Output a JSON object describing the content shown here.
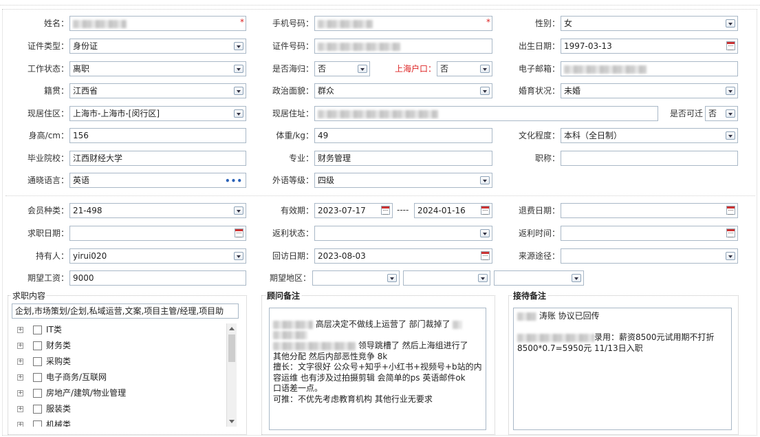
{
  "form": {
    "name_label": "姓名：",
    "phone_label": "手机号码：",
    "gender_label": "性别：",
    "gender_value": "女",
    "idtype_label": "证件类型：",
    "idtype_value": "身份证",
    "idnum_label": "证件号码：",
    "birth_label": "出生日期：",
    "birth_value": "1997-03-13",
    "workstatus_label": "工作状态：",
    "workstatus_value": "离职",
    "returnee_label": "是否海归：",
    "returnee_value": "否",
    "hukou_label": "上海户口：",
    "hukou_value": "否",
    "email_label": "电子邮箱：",
    "native_label": "籍贯：",
    "native_value": "江西省",
    "political_label": "政治面貌：",
    "political_value": "群众",
    "marital_label": "婚育状况：",
    "marital_value": "未婚",
    "area_label": "现居住区：",
    "area_value": "上海市-上海市-[闵行区]",
    "address_label": "现居住址：",
    "relocate_label": "是否可迁",
    "relocate_value": "否",
    "height_label": "身高/cm：",
    "height_value": "156",
    "weight_label": "体重/kg：",
    "weight_value": "49",
    "education_label": "文化程度：",
    "education_value": "本科（全日制）",
    "school_label": "毕业院校：",
    "school_value": "江西财经大学",
    "major_label": "专业：",
    "major_value": "财务管理",
    "title_label": "职称：",
    "title_value": "",
    "language_label": "通晓语言：",
    "language_value": "英语",
    "langlevel_label": "外语等级：",
    "langlevel_value": "四级"
  },
  "membership": {
    "type_label": "会员种类：",
    "type_value": "21-498",
    "valid_label": "有效期：",
    "valid_from": "2023-07-17",
    "valid_sep": "----",
    "valid_to": "2024-01-16",
    "refund_date_label": "退费日期：",
    "jobseek_date_label": "求职日期：",
    "rebate_status_label": "返利状态：",
    "rebate_time_label": "返利时间：",
    "holder_label": "持有人：",
    "holder_value": "yirui020",
    "revisit_label": "回访日期：",
    "revisit_value": "2023-08-03",
    "source_label": "来源途径：",
    "salary_label": "期望工资：",
    "salary_value": "9000",
    "region_label": "期望地区："
  },
  "job_content": {
    "title": "求职内容",
    "summary": "企划,市场策划/企划,私域运营,文案,项目主管/经理,项目助",
    "items": [
      "IT类",
      "财务类",
      "采购类",
      "电子商务/互联网",
      "房地产/建筑/物业管理",
      "服装类",
      "机械类"
    ]
  },
  "consultant_notes": {
    "title": "顾问备注",
    "lines": [
      "高层决定不做线上运营了  部门裁掉了",
      "领导跳槽了 然后上海组进行了",
      "其他分配 然后内部恶性竞争  8k",
      "擅长：文字很好 公众号+知乎+小红书+视频号+b站的内",
      "容运维  也有涉及过拍摄剪辑 会简单的ps  英语邮件ok",
      "口语差一点。",
      "可推：不优先考虑教育机构  其他行业无要求"
    ]
  },
  "reception_notes": {
    "title": "接待备注",
    "lines": [
      "涛账  协议已回传",
      "录用：薪资8500元试用期不打折",
      "8500*0.7=5950元  11/13日入职"
    ]
  },
  "colors": {
    "required": "#dd2222",
    "hukou_label": "#d22222",
    "field_border": "#a9b8c7"
  }
}
